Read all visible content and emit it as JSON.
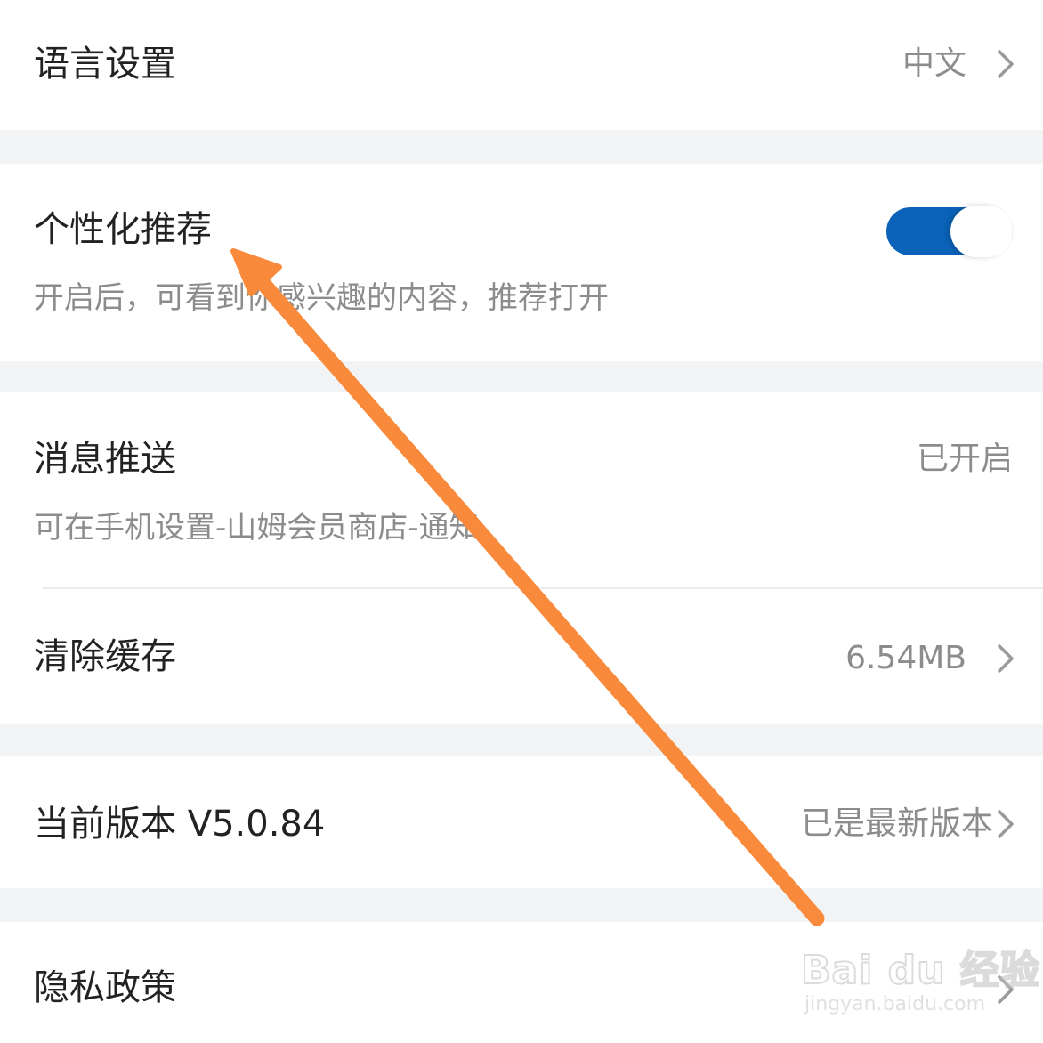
{
  "settings": {
    "language": {
      "label": "语言设置",
      "value": "中文"
    },
    "personalized": {
      "label": "个性化推荐",
      "desc": "开启后，可看到你感兴趣的内容，推荐打开",
      "enabled": true
    },
    "push": {
      "label": "消息推送",
      "value": "已开启",
      "desc": "可在手机设置-山姆会员商店-通知"
    },
    "cache": {
      "label": "清除缓存",
      "value": "6.54MB"
    },
    "version": {
      "label": "当前版本 V5.0.84",
      "value": "已是最新版本"
    },
    "privacy": {
      "label": "隐私政策"
    }
  },
  "watermark": {
    "text": "Bai du 经验",
    "url": "jingyan.baidu.com"
  },
  "colors": {
    "toggle_on": "#0a63b8",
    "arrow": "#f98a3b",
    "secondary_text": "#8c8c8c"
  }
}
